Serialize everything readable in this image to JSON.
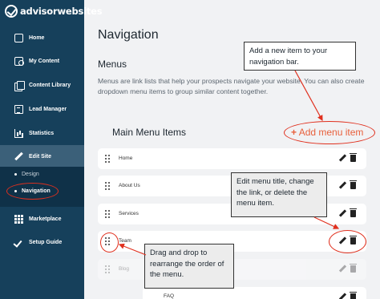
{
  "brand": {
    "name": "advisorwebsites",
    "logo_icon": "checkmark-circle-icon"
  },
  "sidebar": {
    "items": [
      {
        "label": "Home",
        "icon": "home-icon"
      },
      {
        "label": "My Content",
        "icon": "image-icon"
      },
      {
        "label": "Content Library",
        "icon": "library-icon"
      },
      {
        "label": "Lead Manager",
        "icon": "clipboard-icon"
      },
      {
        "label": "Statistics",
        "icon": "bar-chart-icon"
      },
      {
        "label": "Edit Site",
        "icon": "pencil-icon"
      },
      {
        "label": "Marketplace",
        "icon": "grid-icon"
      },
      {
        "label": "Setup Guide",
        "icon": "check-icon"
      }
    ],
    "subitems": [
      {
        "label": "Design"
      },
      {
        "label": "Navigation"
      }
    ]
  },
  "main": {
    "title": "Navigation",
    "section_title": "Menus",
    "description": "Menus are link lists that help your prospects navigate your website. You can also create dropdown menu items to group similar content together.",
    "list_title": "Main Menu Items",
    "add_item_label": "Add menu item",
    "add_item_icon": "plus-icon",
    "rows": [
      {
        "label": "Home"
      },
      {
        "label": "About Us"
      },
      {
        "label": "Services"
      },
      {
        "label": "Team"
      },
      {
        "label": "Blog"
      },
      {
        "label": "FAQ"
      }
    ]
  },
  "callouts": {
    "add": "Add a new item to your navigation bar.",
    "edit": "Edit menu title, change the link, or delete the menu item.",
    "drag": "Drag and drop to rearrange the order of the menu."
  },
  "colors": {
    "sidebar": "#16405b",
    "accent": "#e8603c",
    "annotation": "#e0301e"
  }
}
